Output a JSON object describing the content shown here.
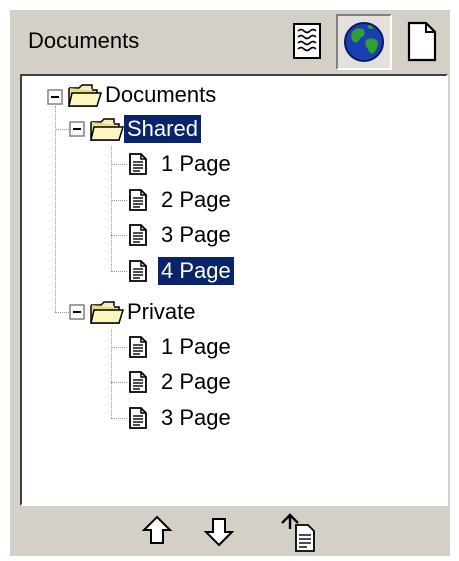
{
  "header": {
    "title": "Documents"
  },
  "tree": {
    "root": {
      "label": "Documents"
    },
    "shared": {
      "label": "Shared",
      "pages": [
        "1 Page",
        "2 Page",
        "3 Page",
        "4 Page"
      ]
    },
    "private": {
      "label": "Private",
      "pages": [
        "1 Page",
        "2 Page",
        "3 Page"
      ]
    }
  },
  "icons": {
    "header": [
      "notes-icon",
      "globe-icon",
      "blank-page-icon"
    ],
    "footer": [
      "arrow-up-icon",
      "arrow-down-icon",
      "undo-document-icon"
    ]
  },
  "colors": {
    "selection": "#0a246a",
    "panel": "#d4d0c8"
  }
}
